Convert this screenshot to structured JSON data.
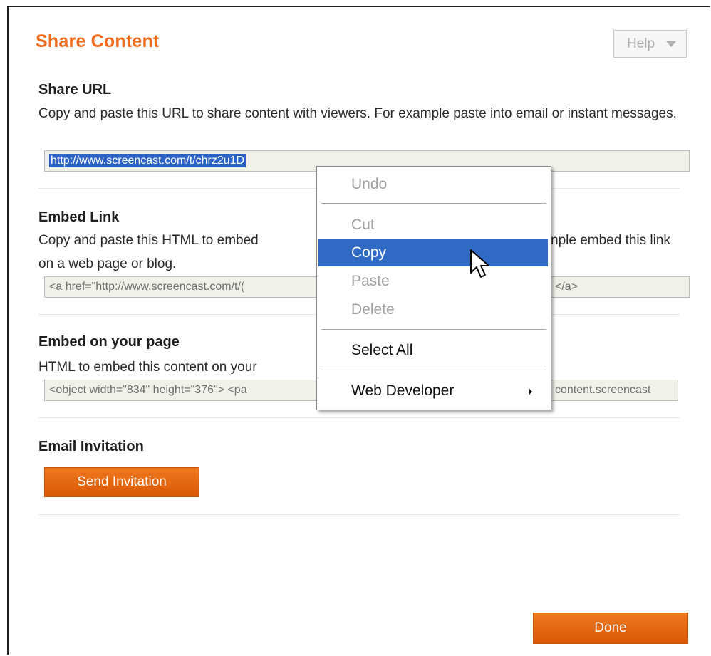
{
  "dialog": {
    "title": "Share Content",
    "help_label": "Help",
    "done_label": "Done"
  },
  "share_url": {
    "heading": "Share URL",
    "description": "Copy and paste this URL to share content with viewers. For example paste into email or instant messages.",
    "value": "http://www.screencast.com/t/chrz2u1D"
  },
  "embed_link": {
    "heading": "Embed Link",
    "description_left": "Copy and paste this HTML to embed",
    "description_right": "nple embed this link",
    "description_line2": "on a web page or blog.",
    "value_left": "<a href=\"http://www.screencast.com/t/(",
    "value_right": "</a>"
  },
  "embed_page": {
    "heading": "Embed on your page",
    "description": "HTML to embed this content on your",
    "value_left": "<object width=\"834\" height=\"376\"> <pa",
    "value_right": "content.screencast"
  },
  "email": {
    "heading": "Email Invitation",
    "button_label": "Send Invitation"
  },
  "context_menu": {
    "items": [
      {
        "label": "Undo",
        "state": "disabled"
      },
      {
        "label": "Cut",
        "state": "disabled"
      },
      {
        "label": "Copy",
        "state": "highlighted"
      },
      {
        "label": "Paste",
        "state": "disabled"
      },
      {
        "label": "Delete",
        "state": "disabled"
      },
      {
        "label": "Select All",
        "state": "enabled"
      },
      {
        "label": "Web Developer",
        "state": "enabled",
        "submenu": true
      }
    ]
  },
  "colors": {
    "accent_orange": "#f26b1d",
    "selection_blue": "#316ac5"
  },
  "icons": [
    "chevron-down-icon",
    "submenu-arrow-icon",
    "mouse-cursor-icon"
  ]
}
